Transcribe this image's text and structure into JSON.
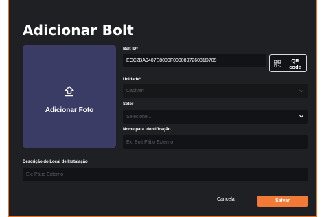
{
  "dialog": {
    "title": "Adicionar Bolt",
    "add_photo_label": "Adicionar Foto",
    "bolt_id": {
      "label": "Bolt ID*",
      "value": "ECC2BA9407E8000F000089726031D709"
    },
    "qr_button": {
      "line1": "QR",
      "line2": "code"
    },
    "unidade": {
      "label": "Unidade*",
      "value": "Capivari"
    },
    "setor": {
      "label": "Setor",
      "placeholder": "Selecione..."
    },
    "nome": {
      "label": "Nome para Identificação",
      "placeholder": "Ex: Bolt Pátio Externo"
    },
    "descricao": {
      "label": "Descrição do Local de Instalação",
      "placeholder": "Ex: Pátio Externo"
    },
    "cancel_label": "Cancelar",
    "save_label": "Salvar"
  },
  "colors": {
    "accent": "#f07a36",
    "photo_box": "#3a3c66",
    "modal_bg": "#1e2024",
    "field_bg": "#121316"
  },
  "icons": [
    "upload-icon",
    "qr-code-icon",
    "chevron-down-icon"
  ]
}
